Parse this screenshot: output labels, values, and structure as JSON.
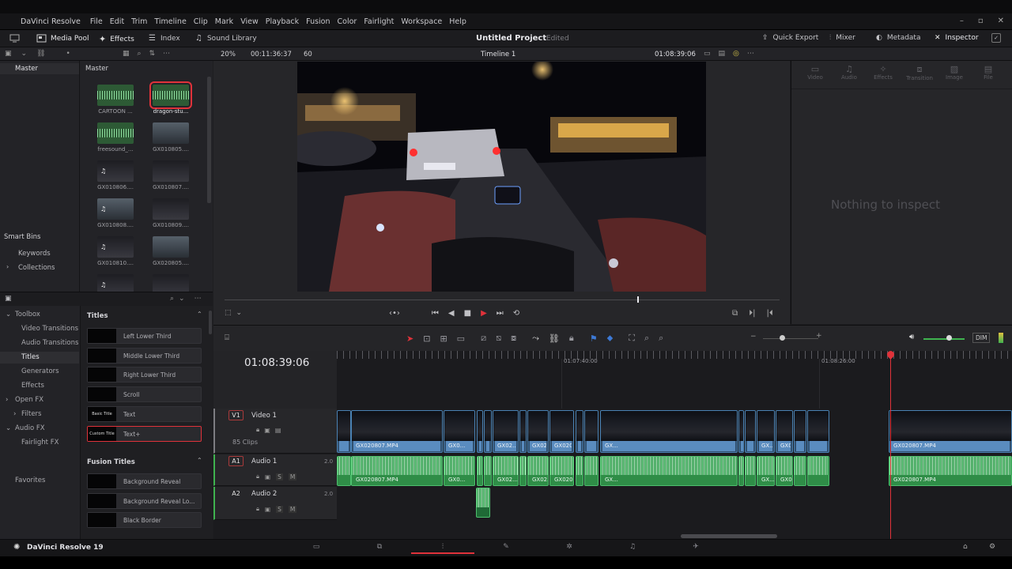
{
  "app": {
    "name": "DaVinci Resolve",
    "brand_name": "DaVinci Resolve 19"
  },
  "menu": [
    "File",
    "Edit",
    "Trim",
    "Timeline",
    "Clip",
    "Mark",
    "View",
    "Playback",
    "Fusion",
    "Color",
    "Fairlight",
    "Workspace",
    "Help"
  ],
  "toolbar": {
    "media_pool": "Media Pool",
    "effects": "Effects",
    "index": "Index",
    "sound_library": "Sound Library",
    "project_title": "Untitled Project",
    "project_status": "Edited",
    "quick_export": "Quick Export",
    "mixer": "Mixer",
    "metadata": "Metadata",
    "inspector": "Inspector"
  },
  "viewer_bar": {
    "zoom": "20%",
    "source_timecode": "00:11:36:37",
    "fps": "60",
    "timeline_name": "Timeline 1",
    "record_timecode": "01:08:39:06"
  },
  "bins": {
    "master_left": "Master",
    "master_grid": "Master",
    "smart_bins": "Smart Bins",
    "keywords": "Keywords",
    "collections": "Collections"
  },
  "media_items": [
    {
      "label": "CARTOON ...",
      "kind": "audio"
    },
    {
      "label": "dragon-stu...",
      "kind": "audio",
      "selected": true
    },
    {
      "label": "freesound_...",
      "kind": "audio"
    },
    {
      "label": "GX010805....",
      "kind": "video"
    },
    {
      "label": "GX010806....",
      "kind": "video"
    },
    {
      "label": "GX010807....",
      "kind": "video"
    },
    {
      "label": "GX010808....",
      "kind": "video"
    },
    {
      "label": "GX010809....",
      "kind": "video"
    },
    {
      "label": "GX010810....",
      "kind": "video"
    },
    {
      "label": "GX020805....",
      "kind": "video"
    },
    {
      "label": "",
      "kind": "video"
    },
    {
      "label": "",
      "kind": "video"
    }
  ],
  "effects_tree": {
    "toolbox": "Toolbox",
    "items": [
      "Video Transitions",
      "Audio Transitions",
      "Titles",
      "Generators",
      "Effects"
    ],
    "open_fx": "Open FX",
    "filters": "Filters",
    "audio_fx": "Audio FX",
    "fairlight_fx": "Fairlight FX",
    "favorites": "Favorites"
  },
  "titles": {
    "heading": "Titles",
    "items": [
      {
        "thumb": "",
        "name": "Left Lower Third"
      },
      {
        "thumb": "",
        "name": "Middle Lower Third"
      },
      {
        "thumb": "",
        "name": "Right Lower Third"
      },
      {
        "thumb": "",
        "name": "Scroll"
      },
      {
        "thumb": "Basic Title",
        "name": "Text"
      },
      {
        "thumb": "Custom Title",
        "name": "Text+",
        "selected": true
      }
    ],
    "fusion_heading": "Fusion Titles",
    "fusion_items": [
      {
        "name": "Background Reveal"
      },
      {
        "name": "Background Reveal Lo..."
      },
      {
        "name": "Black Border"
      }
    ]
  },
  "inspector": {
    "tabs": [
      "Video",
      "Audio",
      "Effects",
      "Transition",
      "Image",
      "File"
    ],
    "empty_message": "Nothing to inspect"
  },
  "timeline": {
    "timecode": "01:08:39:06",
    "ruler_marks": [
      "01:07:40:00",
      "01:08:26:00"
    ],
    "dim": "DIM",
    "tracks": {
      "v1": {
        "tag": "V1",
        "name": "Video 1",
        "clips_count": "85 Clips"
      },
      "a1": {
        "tag": "A1",
        "name": "Audio 1",
        "level": "2.0"
      },
      "a2": {
        "tag": "A2",
        "name": "Audio 2",
        "level": "2.0"
      }
    },
    "video_clips": [
      "GX020807.MP4",
      "GX0...",
      "GX02...",
      "GX02...",
      "GX020807.MP4",
      "GX...",
      "GX...",
      "GX0...",
      "GX020807.MP4"
    ],
    "audio_clips": [
      "GX020807.MP4",
      "GX0...",
      "GX02...",
      "GX02...",
      "GX020807.MP4",
      "GX...",
      "GX...",
      "GX0...",
      "GX020807.MP4"
    ]
  },
  "colors": {
    "accent_red": "#e0323a",
    "video_clip": "#5a8cbf",
    "audio_clip": "#2f8d47"
  }
}
